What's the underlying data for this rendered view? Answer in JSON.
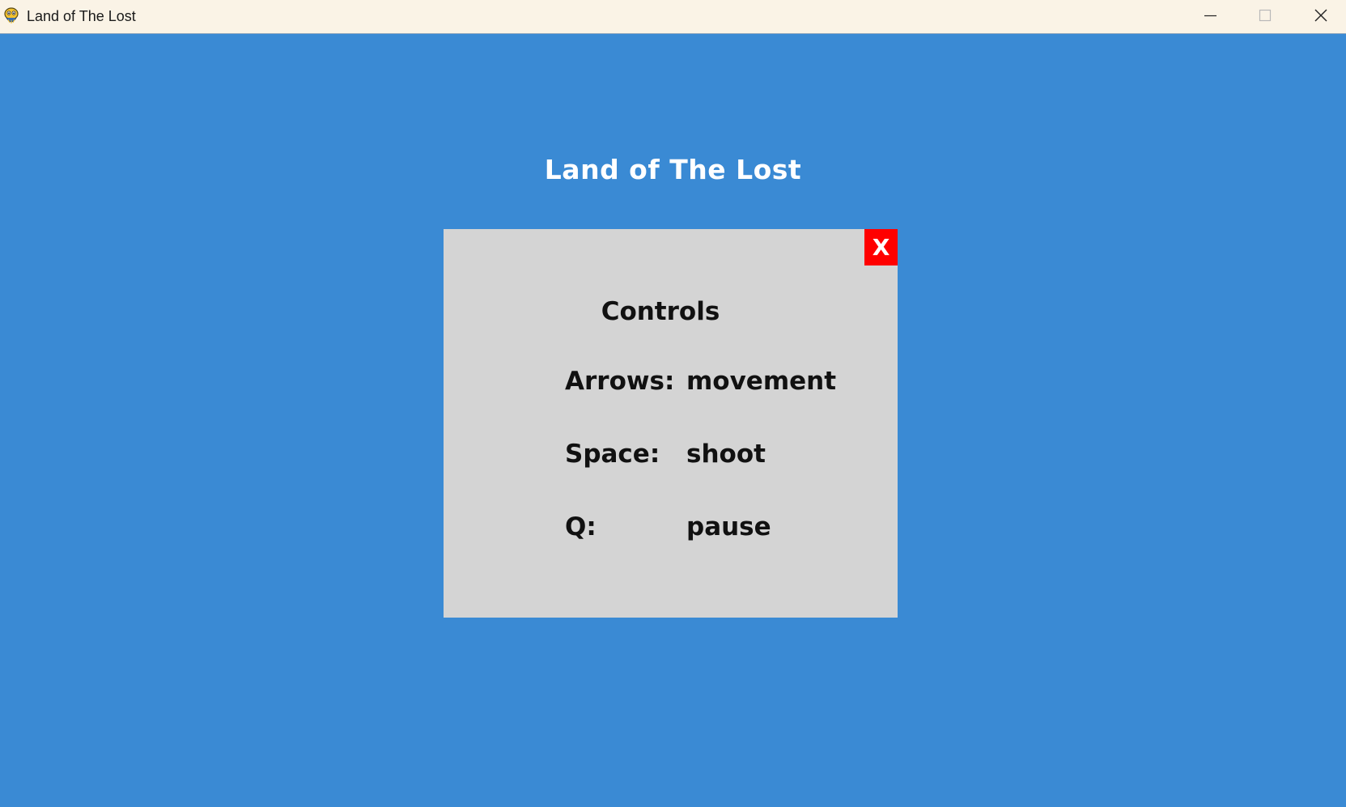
{
  "window": {
    "title": "Land of The Lost",
    "icon": "pygame-snake-icon",
    "controls": {
      "minimize_icon": "minimize-icon",
      "maximize_icon": "maximize-icon",
      "close_icon": "close-icon"
    }
  },
  "game": {
    "title": "Land of The Lost",
    "background_color": "#3a8ad4"
  },
  "controls_panel": {
    "close_label": "X",
    "close_color": "#ff0000",
    "panel_color": "#d4d4d4",
    "heading": "Controls",
    "rows": [
      {
        "key": "Arrows:",
        "action": "movement"
      },
      {
        "key": "Space:",
        "action": "shoot"
      },
      {
        "key": "Q:",
        "action": "pause"
      }
    ]
  }
}
